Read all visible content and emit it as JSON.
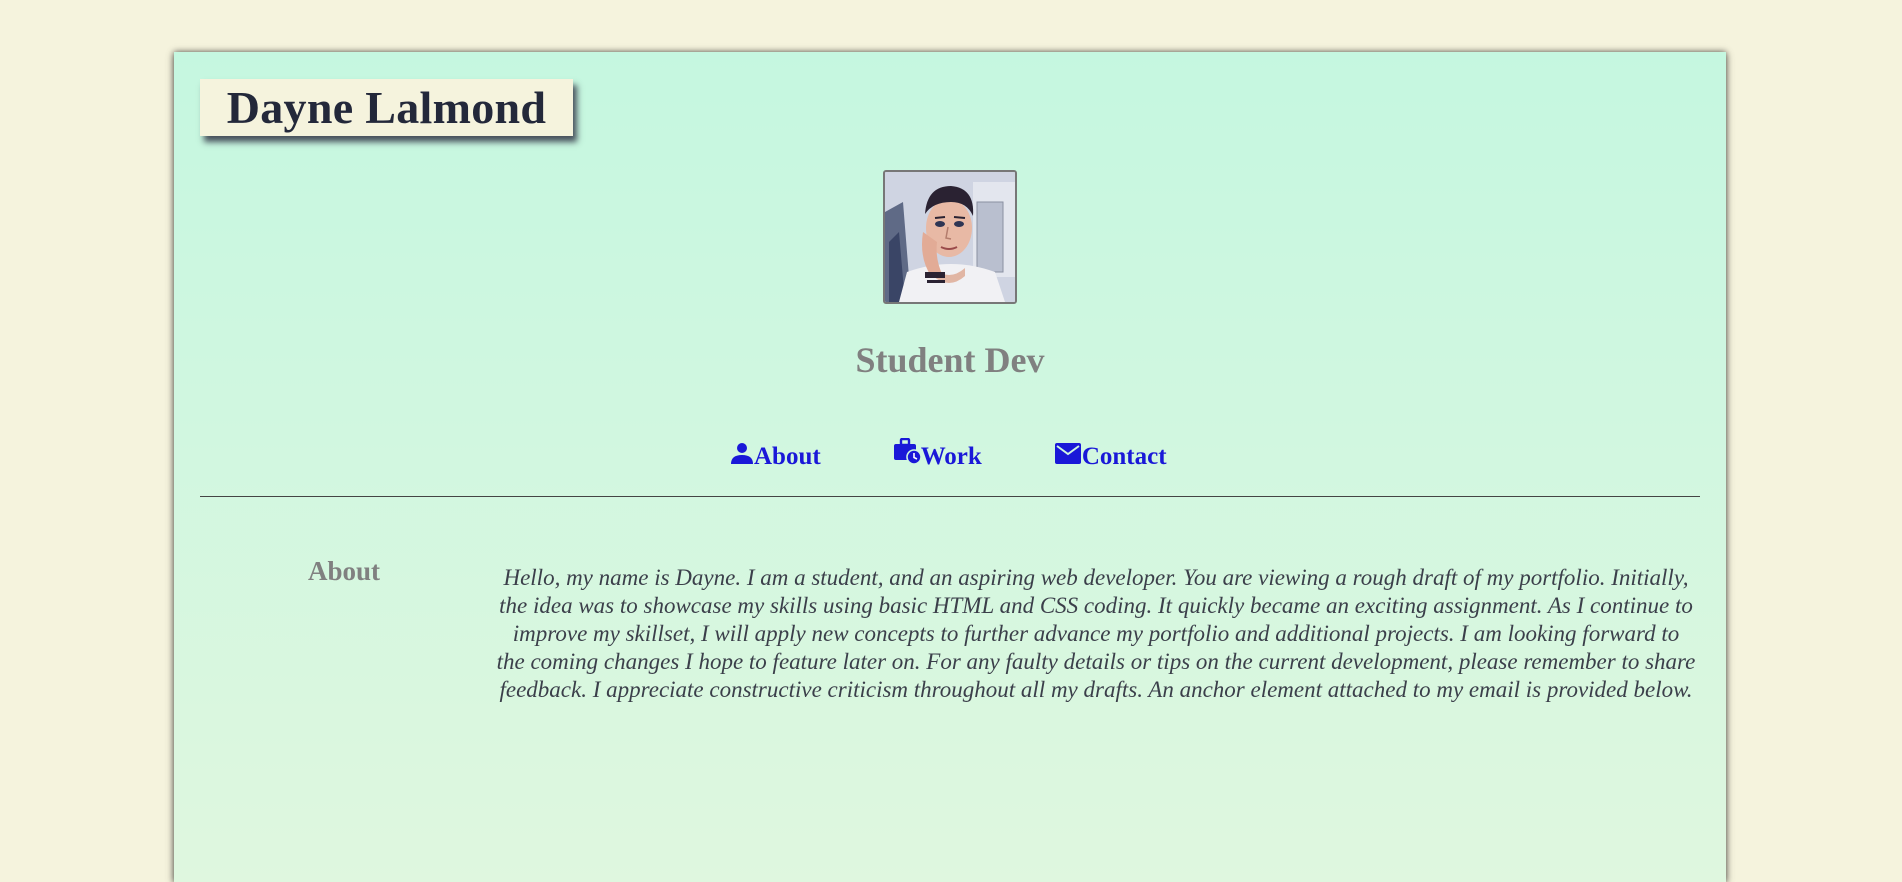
{
  "header": {
    "name": "Dayne Lalmond"
  },
  "profile": {
    "photo": "portrait-illustration",
    "subtitle": "Student Dev"
  },
  "nav": {
    "items": [
      {
        "label": "About",
        "icon": "person-icon"
      },
      {
        "label": "Work",
        "icon": "briefcase-clock-icon"
      },
      {
        "label": "Contact",
        "icon": "envelope-icon"
      }
    ]
  },
  "about": {
    "heading": "About",
    "body": "Hello, my name is Dayne. I am a student, and an aspiring web developer. You are viewing a rough draft of my portfolio. Initially, the idea was to showcase my skills using basic HTML and CSS coding. It quickly became an exciting assignment. As I continue to improve my skillset, I will apply new concepts to further advance my portfolio and additional projects. I am looking forward to the coming changes I hope to feature later on. For any faulty details or tips on the current development, please remember to share feedback. I appreciate constructive criticism throughout all my drafts. An anchor element attached to my email is provided below."
  },
  "colors": {
    "page_bg": "#f5f3dd",
    "card_bg_top": "#c5f7e0",
    "card_bg_bottom": "#dff7df",
    "name_text": "#23283a",
    "muted_heading": "#808080",
    "link": "#1a18d8",
    "body_text": "#3b3f4a"
  }
}
